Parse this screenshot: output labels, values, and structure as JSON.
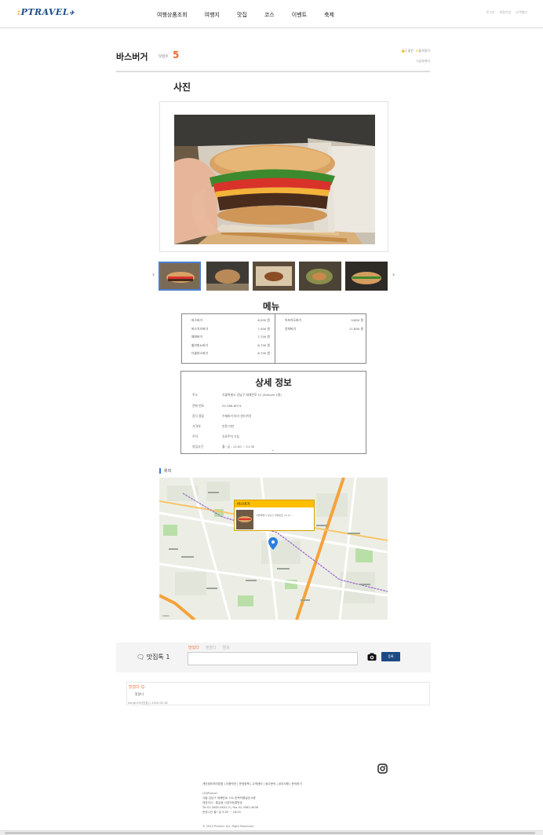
{
  "header": {
    "logo_text": "PTRAVEL",
    "nav": [
      "여행상품조회",
      "여행지",
      "맛집",
      "코스",
      "이벤트",
      "축제"
    ],
    "util": [
      "로그인",
      "회원가입",
      "고객센터"
    ]
  },
  "restaurant": {
    "name": "바스버거",
    "score_label": "맛점수",
    "score": "5",
    "likes": "1 좋은",
    "favorite": "즐겨찾기",
    "share": "공유하기"
  },
  "photo_section": {
    "title": "사진"
  },
  "menu": {
    "title": "메뉴",
    "left": [
      {
        "name": "바스버거",
        "price": "6,500 원"
      },
      {
        "name": "바스치즈버거",
        "price": "7,400 원"
      },
      {
        "name": "페퍼버거",
        "price": "7,700 원"
      },
      {
        "name": "할라피뇨버거",
        "price": "8,700 원"
      },
      {
        "name": "더블바스버거",
        "price": "8,700 원"
      }
    ],
    "right": [
      {
        "name": "아보카도버거",
        "price": "9,800 원"
      },
      {
        "name": "양파버거",
        "price": "11,800 원"
      }
    ]
  },
  "detail": {
    "title": "상세 정보",
    "rows": [
      {
        "key": "주소",
        "value": "서울특별시 강남구 테헤란로 10 (Sample 1층)"
      },
      {
        "key": "전화 번호",
        "value": "02-568-8074"
      },
      {
        "key": "음식 종류",
        "value": "수제버거 버거 샌드위치"
      },
      {
        "key": "가격대",
        "value": "만원 미만"
      },
      {
        "key": "주차",
        "value": "유료주차 가능"
      },
      {
        "key": "영업시간",
        "value": "월~금 : 11:00 ~ 21:30"
      }
    ]
  },
  "location": {
    "label": "위치",
    "marker_title": "바스버거",
    "marker_address": "서울특별시 강남구 테헤란로 10 (S...",
    "scale": "100m"
  },
  "review": {
    "count_label": "맛집톡 1",
    "tabs": [
      "맛있다",
      "괜찮다",
      "별로"
    ],
    "submit": "등록"
  },
  "comment": {
    "tag": "맛있다",
    "text": "맛있다",
    "meta": "hong1234(맛집) | 2020-02-18"
  },
  "footer": {
    "links": "개인정보처리방침 | 이용약관 | 운영정책 | 고객센터 | 광고문의 | 공지사항 | 문의하기",
    "info": [
      "(주)Ptravel",
      "서울 강남구 테헤란로 132 한독약품빌딩 8층",
      "대표이사 : 홍길동 사업자등록번호",
      "Tel 02-3482-4632-5 | Fax 02-3482-4636",
      "운영시간 월~금 9:00 ~ 18:00"
    ],
    "copyright": "© 2020 Ptravel. ALL Right Reserved"
  }
}
